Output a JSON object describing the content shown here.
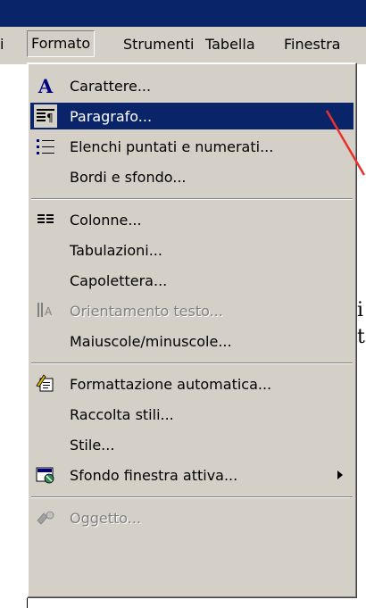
{
  "menubar": {
    "items": [
      {
        "label": "i"
      },
      {
        "label": "Formato"
      },
      {
        "label": "Strumenti"
      },
      {
        "label": "Tabella"
      },
      {
        "label": "Finestra"
      }
    ]
  },
  "menu": {
    "items": [
      {
        "label": "Carattere...",
        "icon": "font-icon"
      },
      {
        "label": "Paragrafo...",
        "icon": "paragraph-icon",
        "selected": true
      },
      {
        "label": "Elenchi puntati e numerati...",
        "icon": "bullets-icon"
      },
      {
        "label": "Bordi e sfondo..."
      },
      {
        "label": "Colonne...",
        "icon": "columns-icon"
      },
      {
        "label": "Tabulazioni..."
      },
      {
        "label": "Capolettera..."
      },
      {
        "label": "Orientamento testo...",
        "icon": "text-direction-icon",
        "disabled": true
      },
      {
        "label": "Maiuscole/minuscole..."
      },
      {
        "label": "Formattazione automatica...",
        "icon": "autoformat-icon"
      },
      {
        "label": "Raccolta stili..."
      },
      {
        "label": "Stile..."
      },
      {
        "label": "Sfondo finestra attiva...",
        "icon": "background-icon",
        "submenu": true
      },
      {
        "label": "Oggetto...",
        "icon": "object-icon",
        "disabled": true
      }
    ]
  },
  "colors": {
    "menu_bg": "#d4d0c8",
    "highlight": "#0a246a",
    "annotation": "#e8322a"
  }
}
